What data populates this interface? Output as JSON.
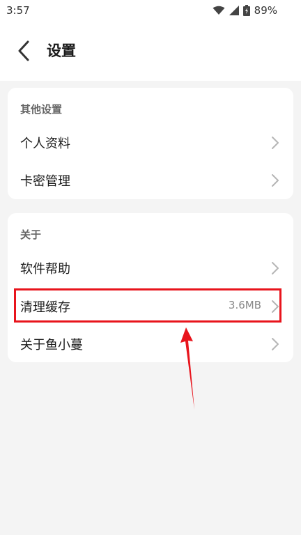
{
  "status_bar": {
    "time": "3:57",
    "battery": "89%"
  },
  "header": {
    "title": "设置"
  },
  "sections": [
    {
      "title": "其他设置",
      "items": [
        {
          "label": "个人资料",
          "value": ""
        },
        {
          "label": "卡密管理",
          "value": ""
        }
      ]
    },
    {
      "title": "关于",
      "items": [
        {
          "label": "软件帮助",
          "value": ""
        },
        {
          "label": "清理缓存",
          "value": "3.6MB"
        },
        {
          "label": "关于鱼小蔓",
          "value": ""
        }
      ]
    }
  ],
  "colors": {
    "annotation": "#e8141c",
    "background": "#f4f4f4",
    "card": "#ffffff"
  },
  "icons": [
    "back-arrow-icon",
    "wifi-icon",
    "signal-icon",
    "battery-icon",
    "chevron-right-icon"
  ]
}
